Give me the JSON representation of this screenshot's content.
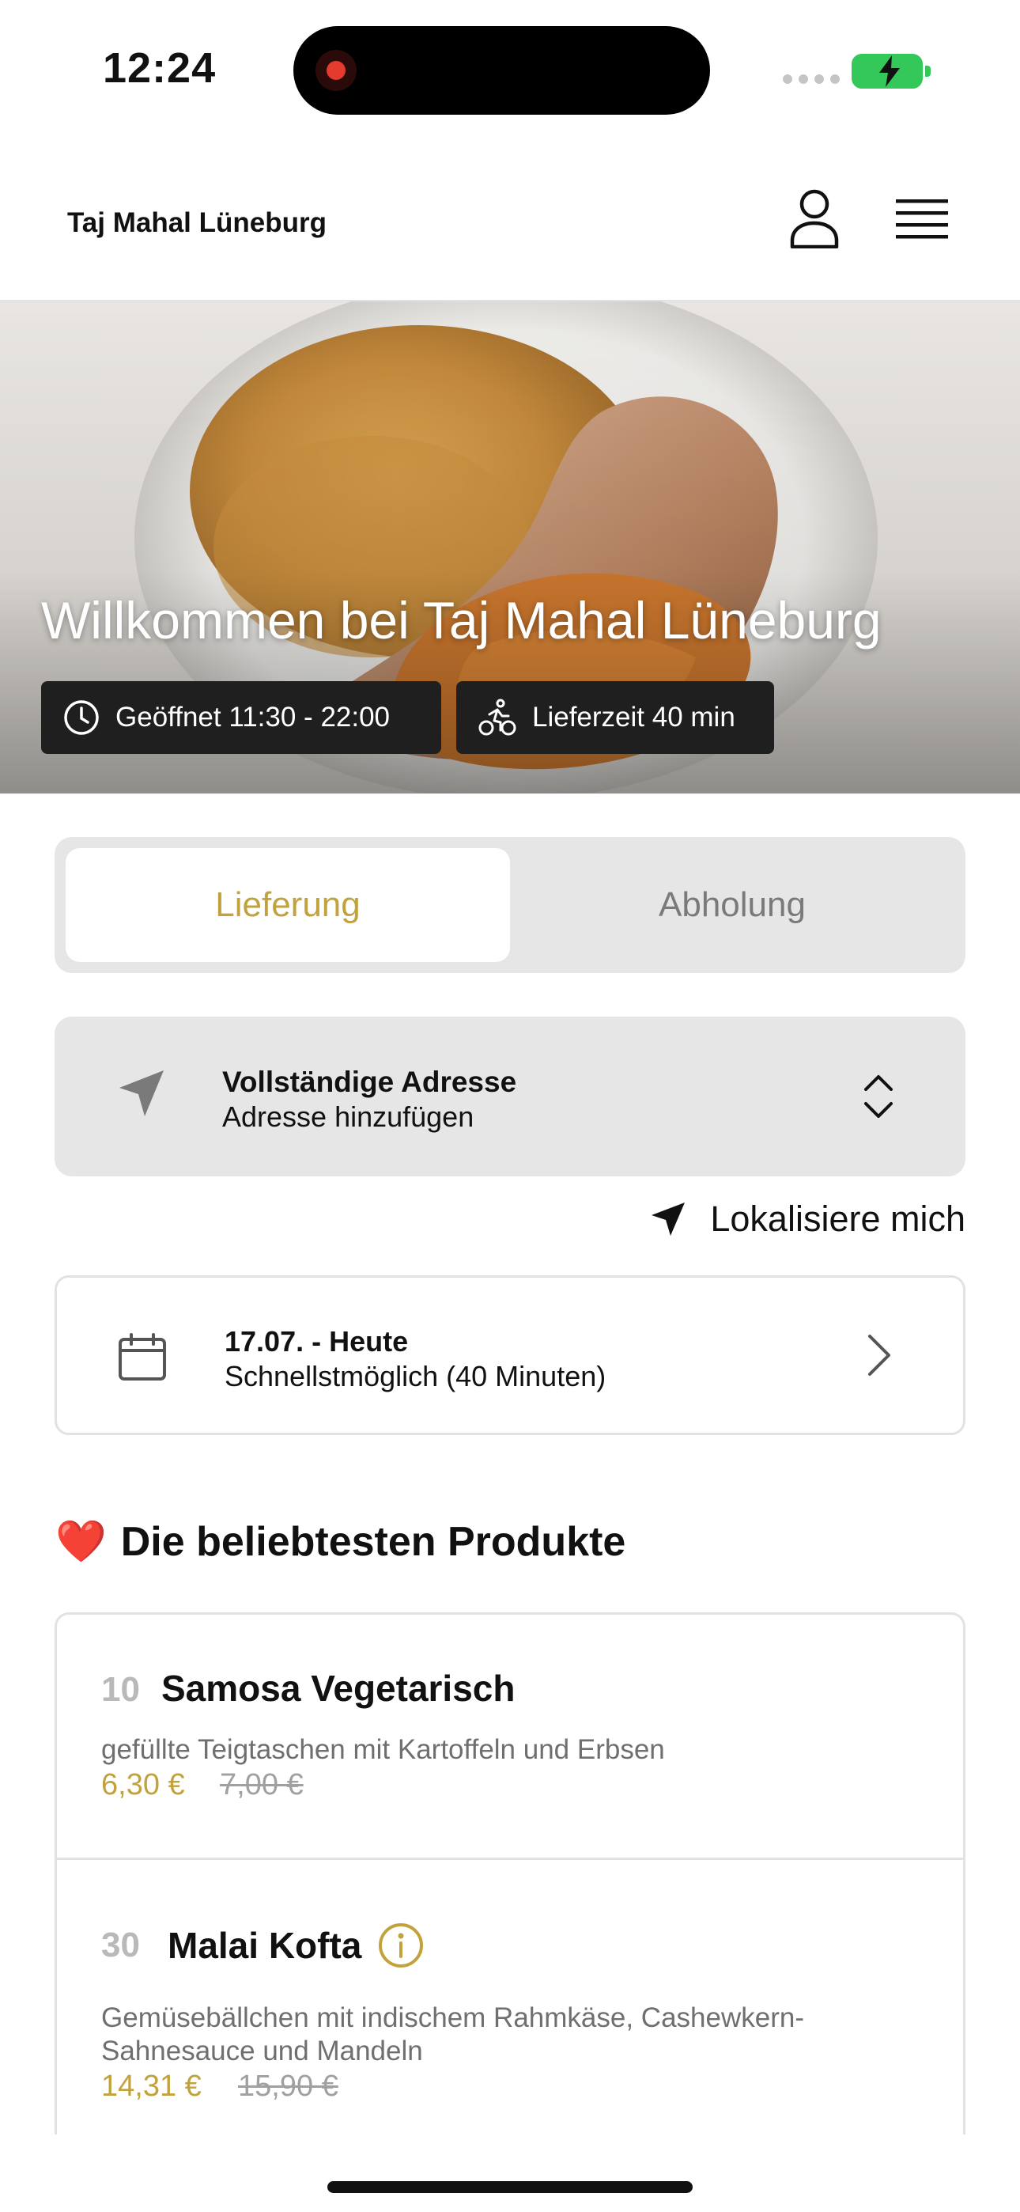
{
  "status_bar": {
    "time": "12:24"
  },
  "header": {
    "brand": "Taj Mahal Lüneburg"
  },
  "hero": {
    "title": "Willkommen bei Taj Mahal Lüneburg",
    "opening_hours": "Geöffnet 11:30 - 22:00",
    "delivery_time": "Lieferzeit 40 min"
  },
  "order_mode": {
    "delivery": "Lieferung",
    "pickup": "Abholung",
    "selected": "Lieferung"
  },
  "address": {
    "title": "Vollständige Adresse",
    "subtitle": "Adresse hinzufügen"
  },
  "locate_label": "Lokalisiere mich",
  "schedule": {
    "date": "17.07. - Heute",
    "time": "Schnellstmöglich (40 Minuten)"
  },
  "popular": {
    "title": "Die beliebtesten Produkte",
    "emoji": "❤️",
    "products": [
      {
        "number": "10",
        "name": "Samosa Vegetarisch",
        "description": "gefüllte Teigtaschen mit Kartoffeln und Erbsen",
        "price": "6,30 €",
        "old_price": "7,00 €"
      },
      {
        "number": "30",
        "name": "Malai Kofta",
        "description": "Gemüsebällchen mit indischem Rahmkäse, Cashewkern-Sahnesauce und Mandeln",
        "price": "14,31 €",
        "old_price": "15,90 €"
      }
    ]
  },
  "colors": {
    "accent": "#c2a23c",
    "pill_bg": "#1f1f1f",
    "panel_bg": "#e6e6e6",
    "battery": "#34c759"
  },
  "icons": [
    "clock-icon",
    "bike-icon",
    "user-icon",
    "menu-icon",
    "navigation-arrow-icon",
    "chevron-updown-icon",
    "calendar-icon",
    "chevron-right-icon",
    "info-icon"
  ]
}
